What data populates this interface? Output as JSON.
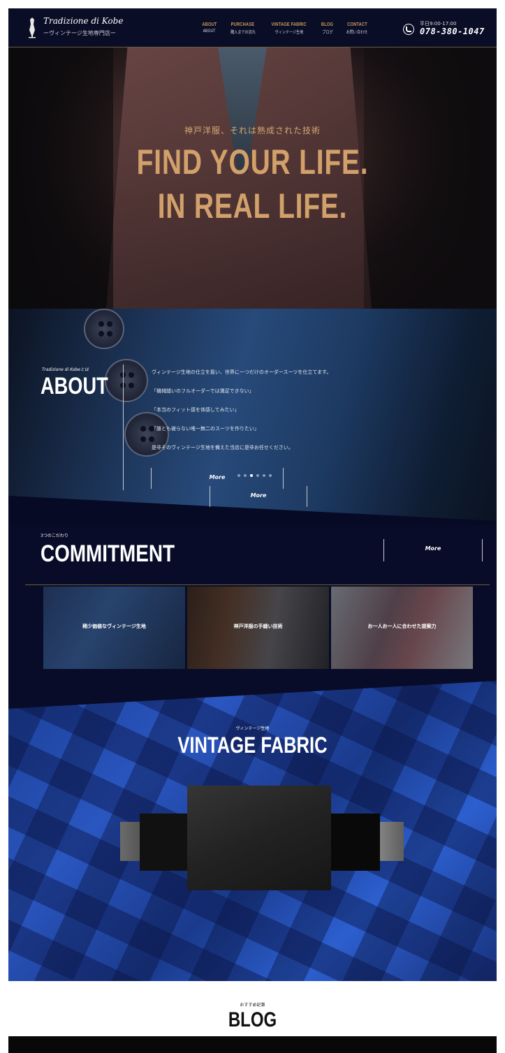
{
  "header": {
    "logo_title": "Tradizione di Kobe",
    "logo_sub": "ーヴィンテージ生地専門店ー",
    "nav": [
      {
        "en": "ABOUT",
        "ja": "ABOUT"
      },
      {
        "en": "PURCHASE",
        "ja": "購入までの流れ"
      },
      {
        "en": "VINTAGE FABRIC",
        "ja": "ヴィンテージ生地"
      },
      {
        "en": "BLOG",
        "ja": "ブログ"
      },
      {
        "en": "CONTACT",
        "ja": "お問い合わせ"
      }
    ],
    "phone_hours": "平日9:00-17:00",
    "phone_number": "078-380-1047"
  },
  "hero": {
    "subtitle": "神戸洋服、それは熟成された技術",
    "line1": "FIND YOUR LIFE.",
    "line2": "IN REAL LIFE."
  },
  "about": {
    "kicker": "Tradizione di Kobeとは",
    "title": "ABOUT",
    "lines": [
      "ヴィンテージ生地の仕立を扱い、世界に一つだけのオーダースーツを仕立てます。",
      "「機械縫いのフルオーダーでは満足できない」",
      "「本当のフィット感を体感してみたい」",
      "「誰とも被らない唯一無二のスーツを作りたい」",
      "是非そのヴィンテージ生地を備えた当店に是非お任せください。"
    ],
    "more": "More"
  },
  "commitment": {
    "kicker": "3つのこだわり",
    "title": "COMMITMENT",
    "more": "More",
    "cards": [
      {
        "label": "稀少価値なヴィンテージ生地"
      },
      {
        "label": "神戸洋服の手縫い技術"
      },
      {
        "label": "お一人お一人に合わせた提案力"
      }
    ]
  },
  "vintage": {
    "kicker": "ヴィンテージ生地",
    "title": "VINTAGE FABRIC",
    "more": "More",
    "slide_count": 6,
    "active_slide": 3
  },
  "blog": {
    "kicker": "おすすめ記事",
    "title": "BLOG"
  },
  "colors": {
    "navy": "#080c28",
    "gold": "#d2a06a",
    "fabric_blue": "#2a56c0"
  }
}
